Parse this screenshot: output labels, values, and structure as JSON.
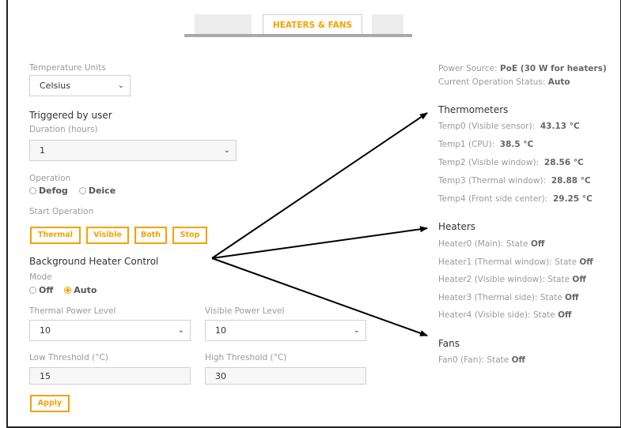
{
  "tabs": {
    "active_label": "HEATERS & FANS"
  },
  "temperature_units": {
    "label": "Temperature Units",
    "value": "Celsius"
  },
  "triggered": {
    "title": "Triggered by user",
    "duration_label": "Duration (hours)",
    "duration_value": "1",
    "operation_label": "Operation",
    "option_defog": "Defog",
    "option_deice": "Deice",
    "start_label": "Start Operation",
    "buttons": {
      "thermal": "Thermal",
      "visible": "Visible",
      "both": "Both",
      "stop": "Stop"
    }
  },
  "background": {
    "title": "Background Heater Control",
    "mode_label": "Mode",
    "mode_off": "Off",
    "mode_auto": "Auto",
    "thermal_label": "Thermal Power Level",
    "thermal_value": "10",
    "visible_label": "Visible Power Level",
    "visible_value": "10",
    "low_label": "Low Threshold (°C)",
    "low_value": "15",
    "high_label": "High Threshold (°C)",
    "high_value": "30",
    "apply_label": "Apply"
  },
  "status": {
    "power_label": "Power Source:",
    "power_value": "PoE (30 W for heaters)",
    "op_label": "Current Operation Status:",
    "op_value": "Auto"
  },
  "thermometers": {
    "title": "Thermometers",
    "items": [
      {
        "label": "Temp0 (Visible sensor):",
        "value": "43.13 °C"
      },
      {
        "label": "Temp1 (CPU):",
        "value": "38.5 °C"
      },
      {
        "label": "Temp2 (Visible window):",
        "value": "28.56 °C"
      },
      {
        "label": "Temp3 (Thermal window):",
        "value": "28.88 °C"
      },
      {
        "label": "Temp4 (Front side center):",
        "value": "29.25 °C"
      }
    ]
  },
  "heaters": {
    "title": "Heaters",
    "state_word": "State",
    "items": [
      {
        "label": "Heater0 (Main):",
        "value": "Off"
      },
      {
        "label": "Heater1 (Thermal window):",
        "value": "Off"
      },
      {
        "label": "Heater2 (Visible window):",
        "value": "Off"
      },
      {
        "label": "Heater3 (Thermal side):",
        "value": "Off"
      },
      {
        "label": "Heater4 (Visible side):",
        "value": "Off"
      }
    ]
  },
  "fans": {
    "title": "Fans",
    "state_word": "State",
    "items": [
      {
        "label": "Fan0 (Fan):",
        "value": "Off"
      }
    ]
  },
  "colors": {
    "accent": "#f5a200",
    "muted_text": "#9a9a9a",
    "arrow": "#000000"
  },
  "icons": {
    "select_arrow": "chevron-down-icon",
    "radio": "radio-icon"
  }
}
